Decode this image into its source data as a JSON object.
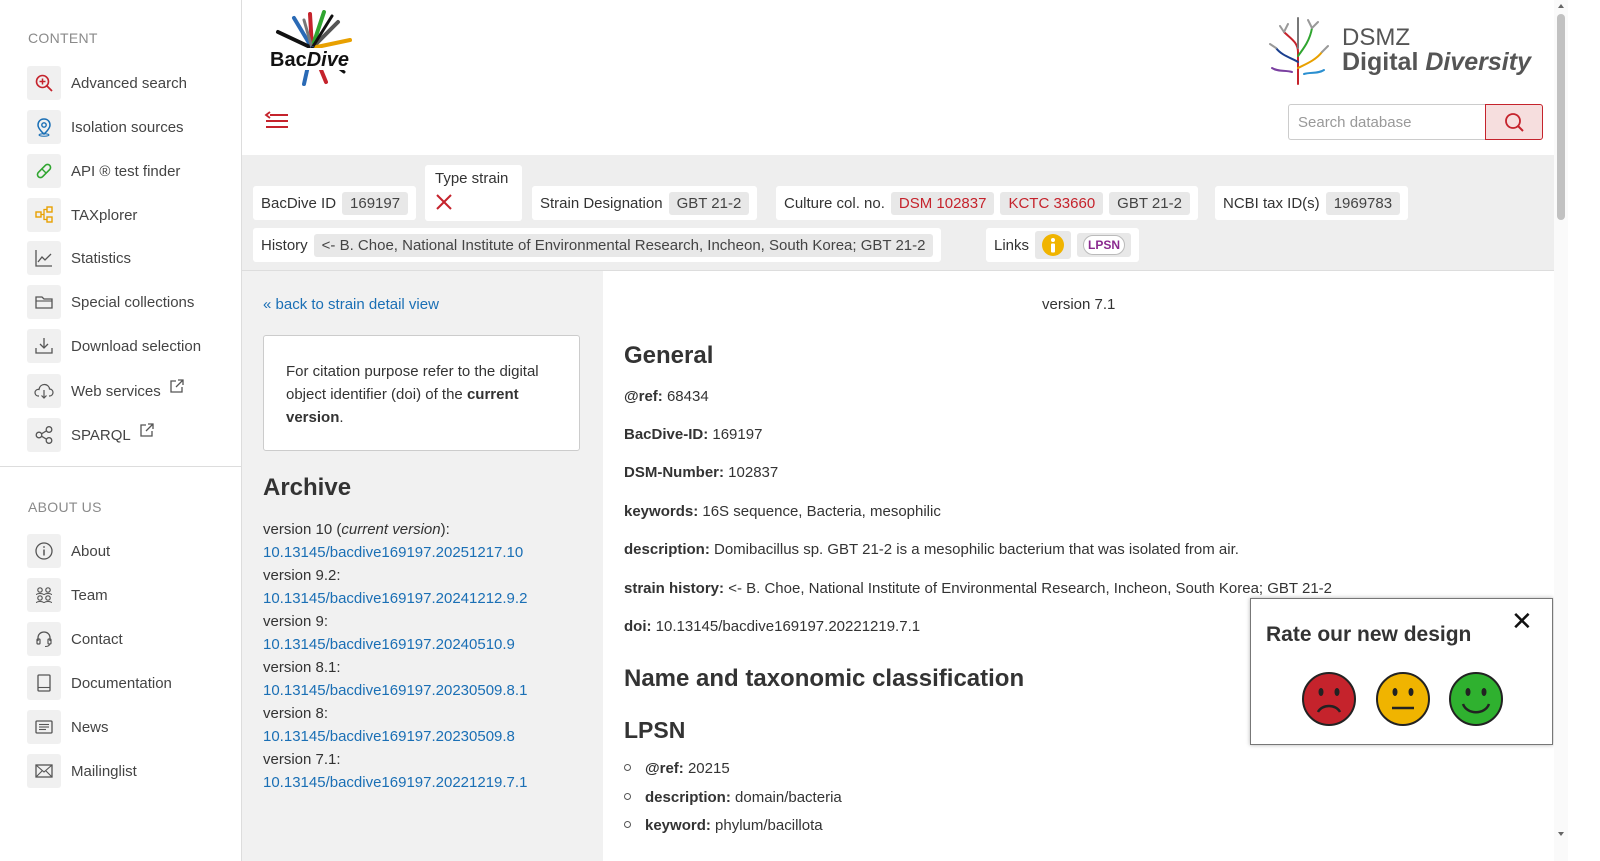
{
  "sidebar": {
    "content_title": "CONTENT",
    "about_title": "ABOUT US",
    "content_items": [
      {
        "label": "Advanced search",
        "icon": "search-plus-icon"
      },
      {
        "label": "Isolation sources",
        "icon": "map-pin-icon"
      },
      {
        "label": "API ® test finder",
        "icon": "pill-icon"
      },
      {
        "label": "TAXplorer",
        "icon": "tree-icon"
      },
      {
        "label": "Statistics",
        "icon": "line-chart-icon"
      },
      {
        "label": "Special collections",
        "icon": "folder-icon"
      },
      {
        "label": "Download selection",
        "icon": "download-icon"
      },
      {
        "label": "Web services",
        "icon": "cloud-download-icon"
      },
      {
        "label": "SPARQL",
        "icon": "share-nodes-icon"
      }
    ],
    "about_items": [
      {
        "label": "About",
        "icon": "info-icon"
      },
      {
        "label": "Team",
        "icon": "team-icon"
      },
      {
        "label": "Contact",
        "icon": "headset-icon"
      },
      {
        "label": "Documentation",
        "icon": "book-icon"
      },
      {
        "label": "News",
        "icon": "newspaper-icon"
      },
      {
        "label": "Mailinglist",
        "icon": "envelope-icon"
      }
    ]
  },
  "header": {
    "logo_text": "BacDive",
    "dsmz_line1": "DSMZ",
    "dsmz_line2a": "Digital",
    "dsmz_line2b": "Diversity",
    "search_placeholder": "Search database"
  },
  "infobar": {
    "bacdive_id_label": "BacDive ID",
    "bacdive_id": "169197",
    "type_strain_label": "Type strain",
    "strain_designation_label": "Strain Designation",
    "strain_designation": "GBT 21-2",
    "culture_label": "Culture col. no.",
    "culture_numbers": [
      "DSM 102837",
      "KCTC 33660",
      "GBT 21-2"
    ],
    "ncbi_label": "NCBI tax ID(s)",
    "ncbi_id": "1969783",
    "history_label": "History",
    "history": "<- B. Choe, National Institute of Environmental Research, Incheon, South Korea; GBT 21-2",
    "links_label": "Links",
    "lpsn": "LPSN"
  },
  "left": {
    "back_link": "« back to strain detail view",
    "cite_text_1": "For citation purpose refer to the digital object identifier (doi) of the ",
    "cite_bold": "current version",
    "cite_text_2": ".",
    "archive_title": "Archive",
    "versions": [
      {
        "label": "version 10 (",
        "current": "current version",
        "suffix": "):",
        "doi": "10.13145/bacdive169197.20251217.10"
      },
      {
        "label": "version 9.2:",
        "doi": "10.13145/bacdive169197.20241212.9.2"
      },
      {
        "label": "version 9:",
        "doi": "10.13145/bacdive169197.20240510.9"
      },
      {
        "label": "version 8.1:",
        "doi": "10.13145/bacdive169197.20230509.8.1"
      },
      {
        "label": "version 8:",
        "doi": "10.13145/bacdive169197.20230509.8"
      },
      {
        "label": "version 7.1:",
        "doi": "10.13145/bacdive169197.20221219.7.1"
      }
    ]
  },
  "main": {
    "version": "version 7.1",
    "general_title": "General",
    "fields": [
      {
        "key": "@ref:",
        "value": " 68434"
      },
      {
        "key": "BacDive-ID:",
        "value": " 169197"
      },
      {
        "key": "DSM-Number:",
        "value": " 102837"
      },
      {
        "key": "keywords:",
        "value": " 16S sequence, Bacteria, mesophilic"
      },
      {
        "key": "description:",
        "value": " Domibacillus sp. GBT 21-2 is a mesophilic bacterium that was isolated from air."
      },
      {
        "key": "strain history:",
        "value": " <- B. Choe, National Institute of Environmental Research, Incheon, South Korea; GBT 21-2"
      },
      {
        "key": "doi:",
        "value": " 10.13145/bacdive169197.20221219.7.1"
      }
    ],
    "taxonomy_title": "Name and taxonomic classification",
    "lpsn_title": "LPSN",
    "lpsn_fields": [
      {
        "key": "@ref:",
        "value": " 20215"
      },
      {
        "key": "description:",
        "value": " domain/bacteria"
      },
      {
        "key": "keyword:",
        "value": " phylum/bacillota"
      }
    ]
  },
  "rating": {
    "title": "Rate our new design",
    "close": "✕",
    "colors": {
      "bad": "#c5232c",
      "neutral": "#f0b400",
      "good": "#2fb12f"
    }
  },
  "colors": {
    "accent": "#c5232c",
    "link": "#1a6fb5"
  }
}
